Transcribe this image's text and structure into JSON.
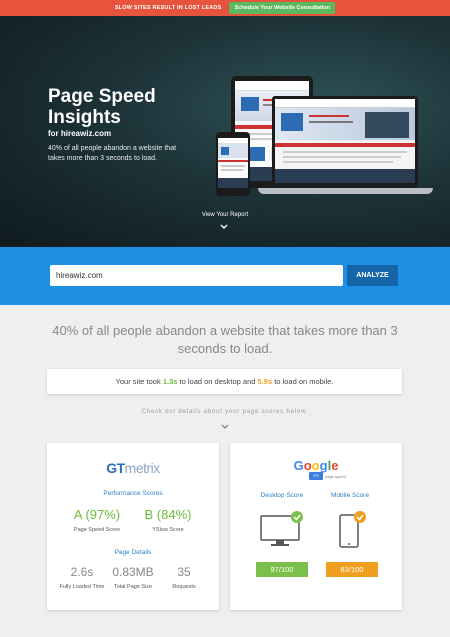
{
  "topbar": {
    "message": "SLOW SITES RESULT IN LOST LEADS",
    "cta": "Schedule Your Website Consultation"
  },
  "hero": {
    "title": "Page Speed Insights",
    "subtitle": "for hireawiz.com",
    "description": "40% of all people abandon a website that takes more than 3 seconds to load.",
    "view_report": "View Your Report"
  },
  "search": {
    "value": "hireawiz.com",
    "button": "ANALYZE"
  },
  "headline": "40% of all people abandon a website that takes more than 3 seconds to load.",
  "result": {
    "prefix": "Your site took ",
    "desktop_time": "1.3s",
    "middle": " to load on desktop and ",
    "mobile_time": "5.9s",
    "suffix": " to load on mobile."
  },
  "details_text": "Check out details about your page scores below.",
  "gtmetrix": {
    "logo_a": "GT",
    "logo_b": "metrix",
    "performance_title": "Performance Scores",
    "pagespeed_score": "A (97%)",
    "pagespeed_label": "Page Speed Score",
    "yslow_score": "B (84%)",
    "yslow_label": "YSlow Score",
    "page_details_title": "Page Details",
    "fully_loaded": "2.6s",
    "fully_loaded_label": "Fully Loaded Time",
    "page_size": "0.83MB",
    "page_size_label": "Total Page Size",
    "requests": "35",
    "requests_label": "Requests"
  },
  "google": {
    "logo": "Google",
    "badge": "PS",
    "sub": "page speed",
    "desktop_title": "Desktop Score",
    "mobile_title": "Mobile Score",
    "desktop_score": "97/100",
    "mobile_score": "83/100"
  },
  "colors": {
    "topbar": "#e8533b",
    "cta_green": "#5cb85c",
    "band_blue": "#1e90e3",
    "analyze_blue": "#1565a8",
    "good_green": "#6cbb3c",
    "warn_orange": "#f0a020"
  }
}
